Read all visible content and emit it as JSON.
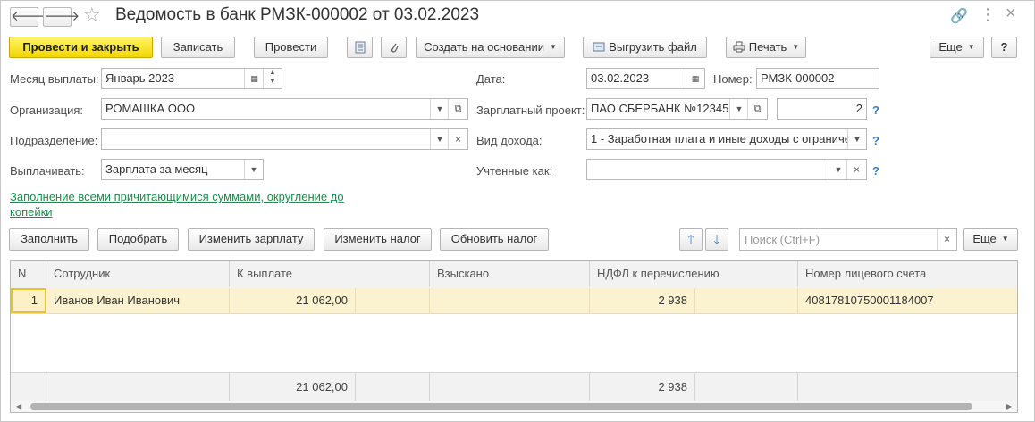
{
  "window": {
    "title": "Ведомость в банк РМЗК-000002 от 03.02.2023",
    "back_glyph": "🡐",
    "forward_glyph": "🡒",
    "star_glyph": "☆",
    "link_glyph": "🔗",
    "menu_glyph": "⋮",
    "close_glyph": "×"
  },
  "toolbar": {
    "post_close": "Провести и закрыть",
    "save": "Записать",
    "post": "Провести",
    "create_based": "Создать на основании",
    "export": "Выгрузить файл",
    "print": "Печать",
    "more": "Еще",
    "help": "?"
  },
  "form": {
    "month_label": "Месяц выплаты:",
    "month_value": "Январь 2023",
    "date_label": "Дата:",
    "date_value": "03.02.2023",
    "number_label": "Номер:",
    "number_value": "РМЗК-000002",
    "org_label": "Организация:",
    "org_value": "РОМАШКА ООО",
    "salary_project_label": "Зарплатный проект:",
    "salary_project_value": "ПАО СБЕРБАНК №12345",
    "salary_project_num": "2",
    "dept_label": "Подразделение:",
    "dept_value": "",
    "income_type_label": "Вид дохода:",
    "income_type_value": "1 - Заработная плата и иные доходы с ограниче",
    "pay_label": "Выплачивать:",
    "pay_value": "Зарплата за месяц",
    "counted_label": "Учтенные как:",
    "counted_value": "",
    "help_mark": "?",
    "fill_link": "Заполнение всеми причитающимися суммами, округление до копейки"
  },
  "table_toolbar": {
    "fill": "Заполнить",
    "pick": "Подобрать",
    "change_salary": "Изменить зарплату",
    "change_tax": "Изменить налог",
    "update_tax": "Обновить налог",
    "search_placeholder": "Поиск (Ctrl+F)",
    "more": "Еще"
  },
  "table": {
    "columns": [
      "N",
      "Сотрудник",
      "К выплате",
      "Взыскано",
      "НДФЛ к перечислению",
      "Номер лицевого счета"
    ],
    "rows": [
      {
        "n": "1",
        "employee": "Иванов Иван Иванович",
        "payout": "21 062,00",
        "withheld": "",
        "ndfl": "2 938",
        "account": "40817810750001184007"
      }
    ],
    "totals": {
      "payout": "21 062,00",
      "ndfl": "2 938"
    }
  }
}
